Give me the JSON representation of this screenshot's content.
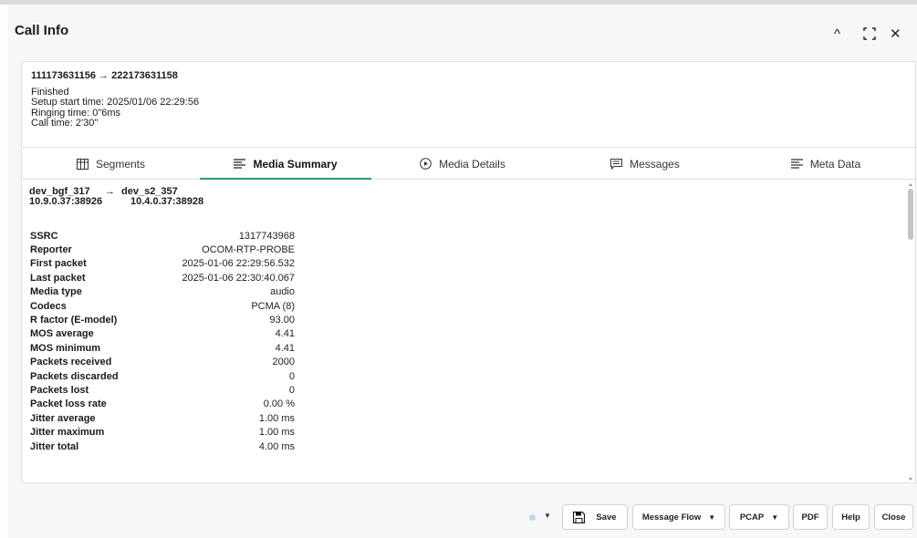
{
  "dialog": {
    "title": "Call Info"
  },
  "window_controls": {
    "collapse": "^",
    "maximize": "⛶",
    "close": "✕"
  },
  "call": {
    "route": "111173631156 → 222173631158",
    "status": "Finished",
    "setup_start": "Setup start time: 2025/01/06 22:29:56",
    "ringing": "Ringing time: 0\"6ms",
    "call_time": "Call time: 2'30\""
  },
  "tabs": [
    {
      "label": "Segments",
      "icon": "segments-icon"
    },
    {
      "label": "Media Summary",
      "icon": "list-icon"
    },
    {
      "label": "Media Details",
      "icon": "play-circle-icon"
    },
    {
      "label": "Messages",
      "icon": "message-icon"
    },
    {
      "label": "Meta Data",
      "icon": "list-icon"
    }
  ],
  "media": {
    "src_name": "dev_bgf_317",
    "arrow": "→",
    "dst_name": "dev_s2_357",
    "src_addr": "10.9.0.37:38926",
    "dst_addr": "10.4.0.37:38928",
    "rows": [
      {
        "k": "SSRC",
        "v": "1317743968"
      },
      {
        "k": "Reporter",
        "v": "OCOM-RTP-PROBE"
      },
      {
        "k": "First packet",
        "v": "2025-01-06 22:29:56.532"
      },
      {
        "k": "Last packet",
        "v": "2025-01-06 22:30:40.067"
      },
      {
        "k": "Media type",
        "v": "audio"
      },
      {
        "k": "Codecs",
        "v": "PCMA (8)"
      },
      {
        "k": "R factor (E-model)",
        "v": "93.00"
      },
      {
        "k": "MOS average",
        "v": "4.41"
      },
      {
        "k": "MOS minimum",
        "v": "4.41"
      },
      {
        "k": "Packets received",
        "v": "2000"
      },
      {
        "k": "Packets discarded",
        "v": "0"
      },
      {
        "k": "Packets lost",
        "v": "0"
      },
      {
        "k": "Packet loss rate",
        "v": "0.00 %"
      },
      {
        "k": "Jitter average",
        "v": "1.00 ms"
      },
      {
        "k": "Jitter maximum",
        "v": "1.00 ms"
      },
      {
        "k": "Jitter total",
        "v": "4.00 ms"
      }
    ]
  },
  "footer": {
    "save": "Save",
    "message_flow": "Message Flow",
    "pcap": "PCAP",
    "pdf": "PDF",
    "help": "Help",
    "close": "Close"
  },
  "colors": {
    "accent": "#2a9d6f",
    "status_dot": "#bcd6ee"
  }
}
